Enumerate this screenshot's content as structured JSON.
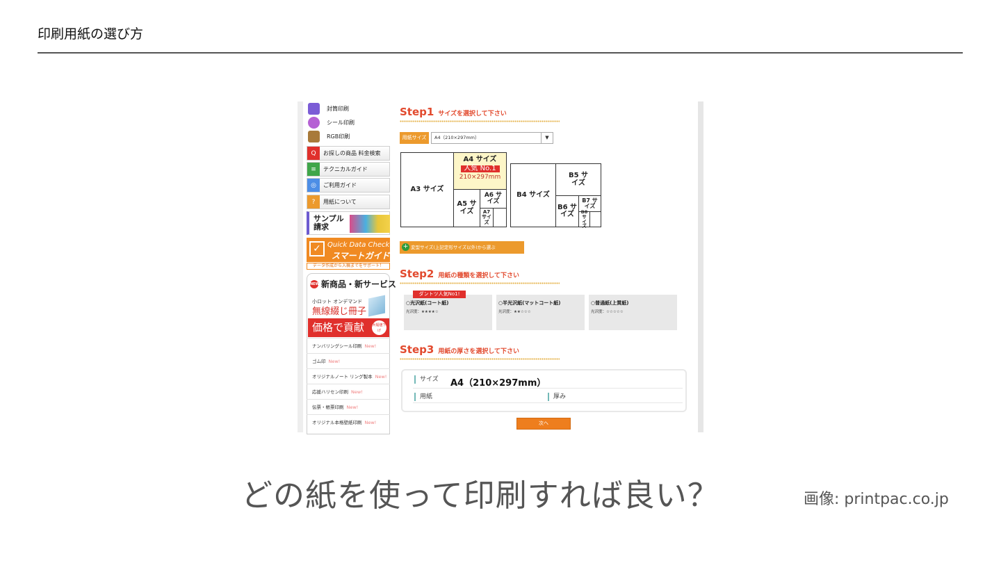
{
  "slide": {
    "title": "印刷用紙の選び方",
    "caption": "どの紙を使って印刷すれば良い？",
    "credit": "画像: printpac.co.jp"
  },
  "sidebar": {
    "categories": [
      {
        "label": "封筒印刷",
        "icon": "envelope-icon",
        "color": "#7b5cd6"
      },
      {
        "label": "シール印刷",
        "icon": "sticker-icon",
        "color": "#b561d4"
      },
      {
        "label": "RGB印刷",
        "icon": "rgb-icon",
        "color": "#a87a3a"
      }
    ],
    "buttons": [
      {
        "label": "お探しの商品 料金検索",
        "icon": "search-icon",
        "color": "#e0302c"
      },
      {
        "label": "テクニカルガイド",
        "icon": "guide-icon",
        "color": "#3fa64a"
      },
      {
        "label": "ご利用ガイド",
        "icon": "bulb-icon",
        "color": "#4d8ee6"
      },
      {
        "label": "用紙について",
        "icon": "question-icon",
        "color": "#ec9a2d"
      }
    ],
    "sample": {
      "label": "サンプル 請求"
    },
    "quick_check": {
      "line1": "Quick Data Check",
      "line2": "スマートガイド",
      "sub": "データ作成から入稿までをサポート！"
    },
    "new_services": {
      "heading": "新商品・新サービス",
      "dot": "NEW",
      "promo_small": "小ロット オンデマンド",
      "promo_large": "無線綴じ冊子",
      "promo_price": "価格で貢献",
      "promo_badge": "大幅値下げ",
      "items": [
        {
          "label": "ナンバリングシール印刷",
          "new": "New!"
        },
        {
          "label": "ゴム印",
          "new": "New!"
        },
        {
          "label": "オリジナルノート リング製本",
          "new": "New!"
        },
        {
          "label": "応援ハリセン印刷",
          "new": "New!"
        },
        {
          "label": "伝票・帳票印刷",
          "new": "New!"
        },
        {
          "label": "オリジナル本格壁紙印刷",
          "new": "New!"
        }
      ]
    }
  },
  "step1": {
    "title": "Step1",
    "subtitle": "サイズを選択して下さい",
    "size_label": "用紙サイズ",
    "size_value": "A4（210×297mm）",
    "sizes": {
      "a3": "A3 サイズ",
      "a4": "A4 サイズ",
      "a4_popular": "人気 No.1",
      "a4_dim": "210×297mm",
      "a5": "A5 サイズ",
      "a6": "A6 サイズ",
      "a7": "A7 サイズ",
      "b4": "B4 サイズ",
      "b5": "B5 サイズ",
      "b6": "B6 サイズ",
      "b7": "B7 サイズ",
      "b8": "B8 サイズ"
    },
    "custom_size": "変型サイズ(上記定形サイズ以外)から選ぶ"
  },
  "step2": {
    "title": "Step2",
    "subtitle": "用紙の種類を選択して下さい",
    "ribbon": "ダントツ人気No1!",
    "papers": [
      {
        "name": "○光沢紙(コート紙)",
        "gloss": "光沢度：★★★★☆"
      },
      {
        "name": "○半光沢紙(マットコート紙)",
        "gloss": "光沢度：★★☆☆☆"
      },
      {
        "name": "○普通紙(上質紙)",
        "gloss": "光沢度：☆☆☆☆☆"
      }
    ]
  },
  "step3": {
    "title": "Step3",
    "subtitle": "用紙の厚さを選択して下さい",
    "size_label": "サイズ",
    "size_value": "A4（210×297mm）",
    "paper_label": "用紙",
    "thickness_label": "厚み",
    "next_button": "次へ"
  }
}
